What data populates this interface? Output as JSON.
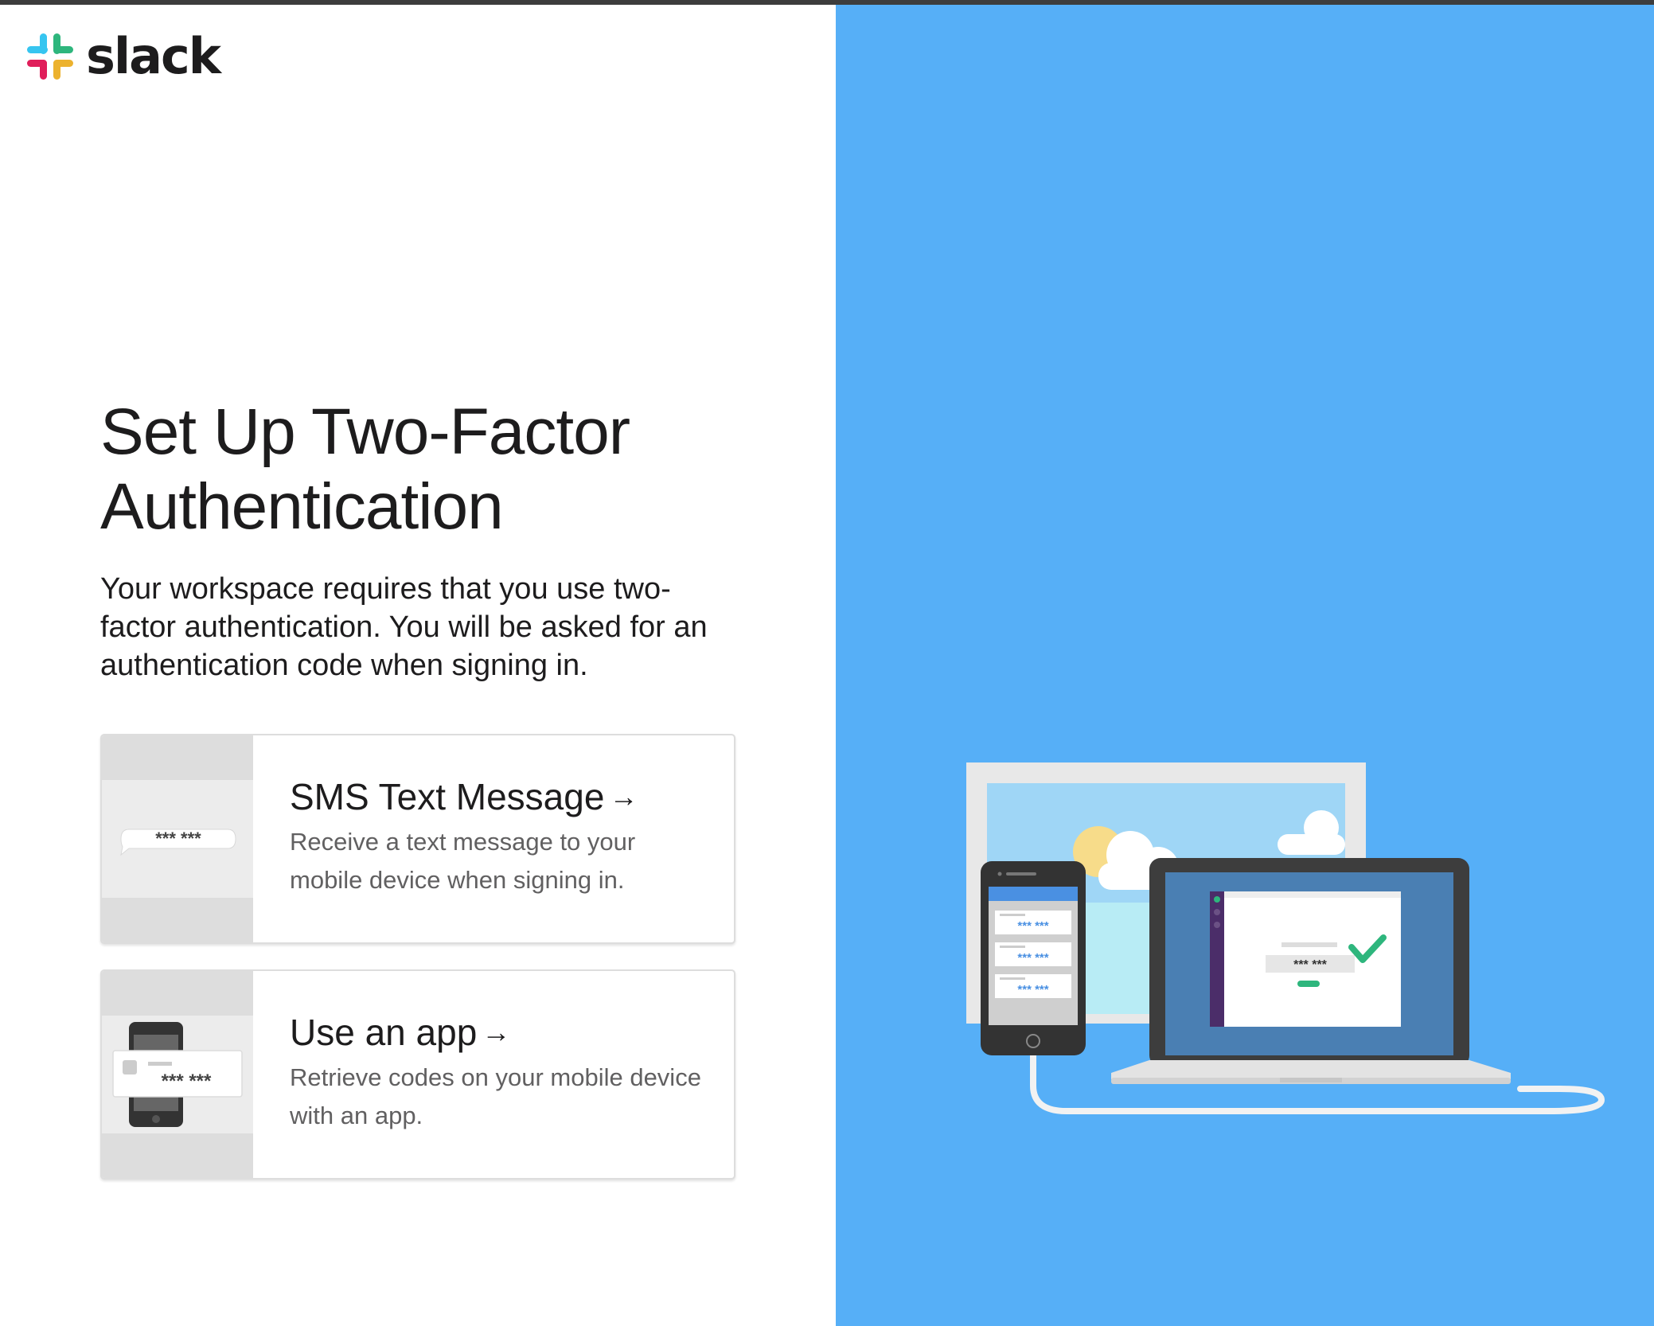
{
  "brand": {
    "name": "slack",
    "colors": {
      "blue": "#36C5F0",
      "green": "#2EB67D",
      "red": "#E01E5A",
      "yellow": "#ECB22E"
    }
  },
  "page": {
    "title": "Set Up Two-Factor Authentication",
    "intro": "Your workspace requires that you use two-factor authentication. You will be asked for an authentication code when signing in."
  },
  "options": [
    {
      "title": "SMS Text Message",
      "description": "Receive a text message to your mobile device when signing in.",
      "arrow_icon": "arrow-right-icon",
      "thumb_code": "*** ***"
    },
    {
      "title": "Use an app",
      "description": "Retrieve codes on your mobile device with an app.",
      "arrow_icon": "arrow-right-icon",
      "thumb_code": "*** ***"
    }
  ],
  "illustration": {
    "codes": [
      "*** ***",
      "*** ***",
      "*** ***"
    ],
    "laptop_code": "*** ***",
    "background_color": "#56aff7"
  }
}
